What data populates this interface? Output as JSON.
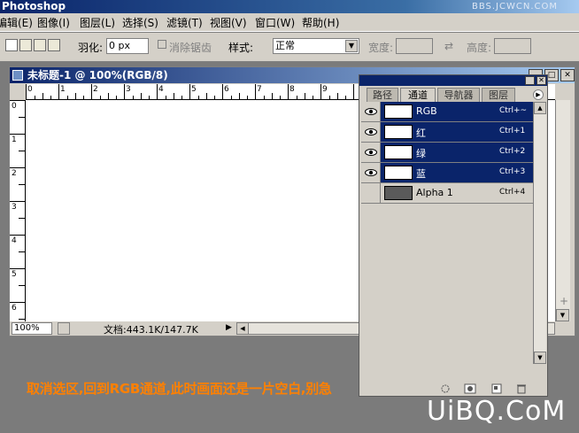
{
  "app": {
    "title": "Photoshop",
    "watermark": "BBS.JCWCN.COM"
  },
  "menu": [
    "编辑(E)",
    "图像(I)",
    "图层(L)",
    "选择(S)",
    "滤镜(T)",
    "视图(V)",
    "窗口(W)",
    "帮助(H)"
  ],
  "options": {
    "feather_label": "羽化:",
    "feather_value": "0 px",
    "antialias_label": "消除锯齿",
    "style_label": "样式:",
    "style_value": "正常",
    "width_label": "宽度:",
    "height_label": "高度:",
    "swap_icon": "⇄"
  },
  "document": {
    "title": "未标题-1 @ 100%(RGB/8)",
    "ruler_h": [
      "0",
      "1",
      "2",
      "3",
      "4",
      "5",
      "6",
      "7",
      "8",
      "9"
    ],
    "ruler_v": [
      "0",
      "1",
      "2",
      "3",
      "4",
      "5",
      "6"
    ],
    "zoom": "100%",
    "doc_size": "文档:443.1K/147.7K"
  },
  "panel": {
    "tabs": [
      "路径",
      "通道",
      "导航器",
      "图层"
    ],
    "active_tab": 1,
    "channels": [
      {
        "name": "RGB",
        "key": "Ctrl+~",
        "selected": true,
        "visible": true
      },
      {
        "name": "红",
        "key": "Ctrl+1",
        "selected": true,
        "visible": true
      },
      {
        "name": "绿",
        "key": "Ctrl+2",
        "selected": true,
        "visible": true
      },
      {
        "name": "蓝",
        "key": "Ctrl+3",
        "selected": true,
        "visible": true
      },
      {
        "name": "Alpha 1",
        "key": "Ctrl+4",
        "selected": false,
        "visible": false
      }
    ]
  },
  "caption": "取消选区,回到RGB通道,此时画面还是一片空白,别急",
  "logo": "UiBQ.CoM",
  "colors": {
    "accent": "#0a246a",
    "caption": "#ff8000"
  }
}
